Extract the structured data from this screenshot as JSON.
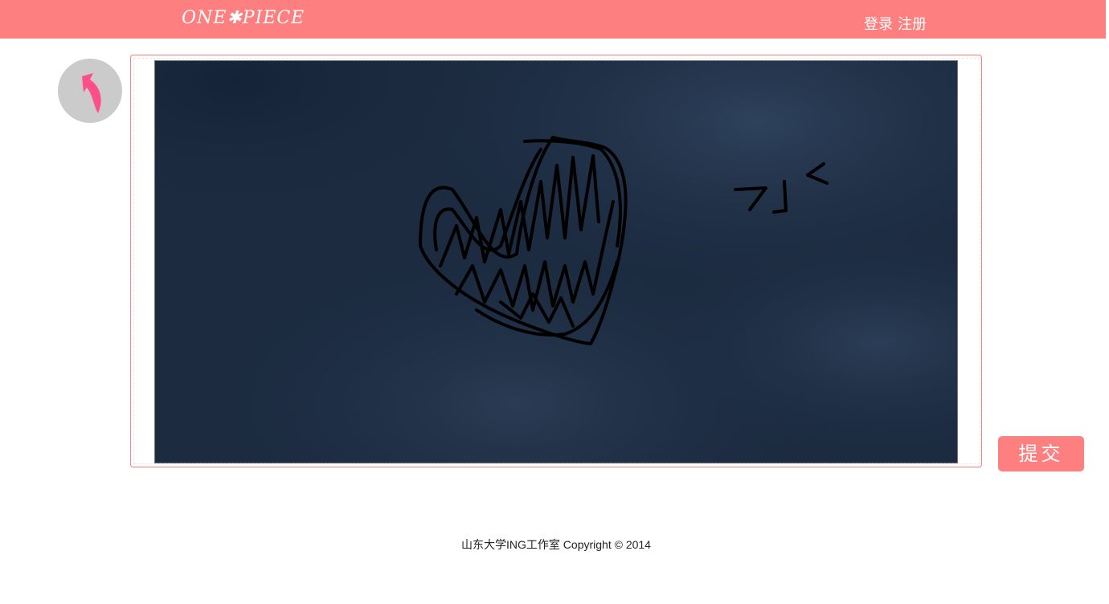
{
  "header": {
    "logo_text": "ONE✱PIECE",
    "login_label": "登录",
    "register_label": "注册"
  },
  "back_button": {
    "icon": "back-arrow-icon"
  },
  "canvas": {
    "drawing": "drawing-canvas"
  },
  "submit_label": "提交",
  "footer": {
    "copyright": "山东大学ING工作室 Copyright © 2014"
  },
  "colors": {
    "accent": "#fe7f7f",
    "back_button_bg": "#cbcbcb",
    "back_arrow": "#ff4f8a",
    "canvas_bg": "#1c2b40",
    "stroke": "#000000"
  }
}
